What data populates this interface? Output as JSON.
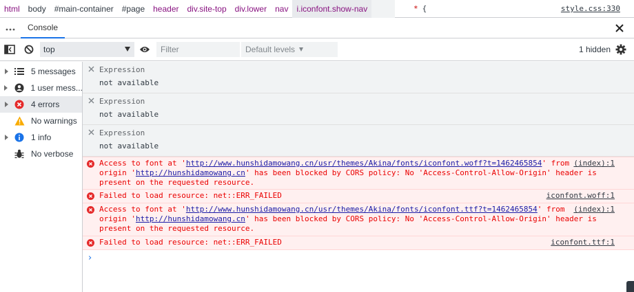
{
  "breadcrumbs": [
    {
      "text": "html",
      "kind": "tag"
    },
    {
      "text": "body",
      "kind": "plain"
    },
    {
      "text": "#main-container",
      "kind": "plain"
    },
    {
      "text": "#page",
      "kind": "plain"
    },
    {
      "text": "header",
      "kind": "tag"
    },
    {
      "text": "div.site-top",
      "kind": "tag"
    },
    {
      "text": "div.lower",
      "kind": "tag"
    },
    {
      "text": "nav",
      "kind": "tag"
    },
    {
      "text": "i.iconfont.show-nav",
      "kind": "sel"
    }
  ],
  "css_rule": {
    "selector": "*",
    "brace": "{",
    "link": "style.css:330"
  },
  "drawer": {
    "more_label": "⋮",
    "tab_console": "Console",
    "close_icon": "close-icon"
  },
  "toolbar": {
    "context": "top",
    "filter_placeholder": "Filter",
    "levels": "Default levels",
    "hidden": "1 hidden"
  },
  "sidebar": {
    "items": [
      {
        "label": "5 messages",
        "icon": "list-icon"
      },
      {
        "label": "1 user mess...",
        "icon": "user-icon"
      },
      {
        "label": "4 errors",
        "icon": "error-icon"
      },
      {
        "label": "No warnings",
        "icon": "warning-icon"
      },
      {
        "label": "1 info",
        "icon": "info-icon"
      },
      {
        "label": "No verbose",
        "icon": "bug-icon"
      }
    ]
  },
  "expressions": [
    {
      "label": "Expression",
      "value": "not available"
    },
    {
      "label": "Expression",
      "value": "not available"
    },
    {
      "label": "Expression",
      "value": "not available"
    }
  ],
  "errors": [
    {
      "pre": "Access to font at '",
      "url": "http://www.hunshidamowang.cn/usr/themes/Akina/fonts/iconfont.woff?t=1462465854",
      "mid": "' from ",
      "line2_pre": "origin '",
      "origin": "http://hunshidamowang.cn",
      "line2_post": "' has been blocked by CORS policy: No 'Access-Control-Allow-Origin' header is",
      "line3": "present on the requested resource.",
      "source": "(index):1"
    },
    {
      "text": "Failed to load resource: net::ERR_FAILED",
      "source": "iconfont.woff:1"
    },
    {
      "pre": "Access to font at '",
      "url": "http://www.hunshidamowang.cn/usr/themes/Akina/fonts/iconfont.ttf?t=1462465854",
      "mid": "' from ",
      "line2_pre": "origin '",
      "origin": "http://hunshidamowang.cn",
      "line2_post": "' has been blocked by CORS policy: No 'Access-Control-Allow-Origin' header is",
      "line3": "present on the requested resource.",
      "source": "(index):1"
    },
    {
      "text": "Failed to load resource: net::ERR_FAILED",
      "source": "iconfont.ttf:1"
    }
  ],
  "prompt": "›",
  "colors": {
    "accent": "#1a73e8",
    "error": "#ea0000",
    "error_bg": "#fff0f0",
    "warning": "#f9ab00",
    "info": "#1a73e8"
  }
}
